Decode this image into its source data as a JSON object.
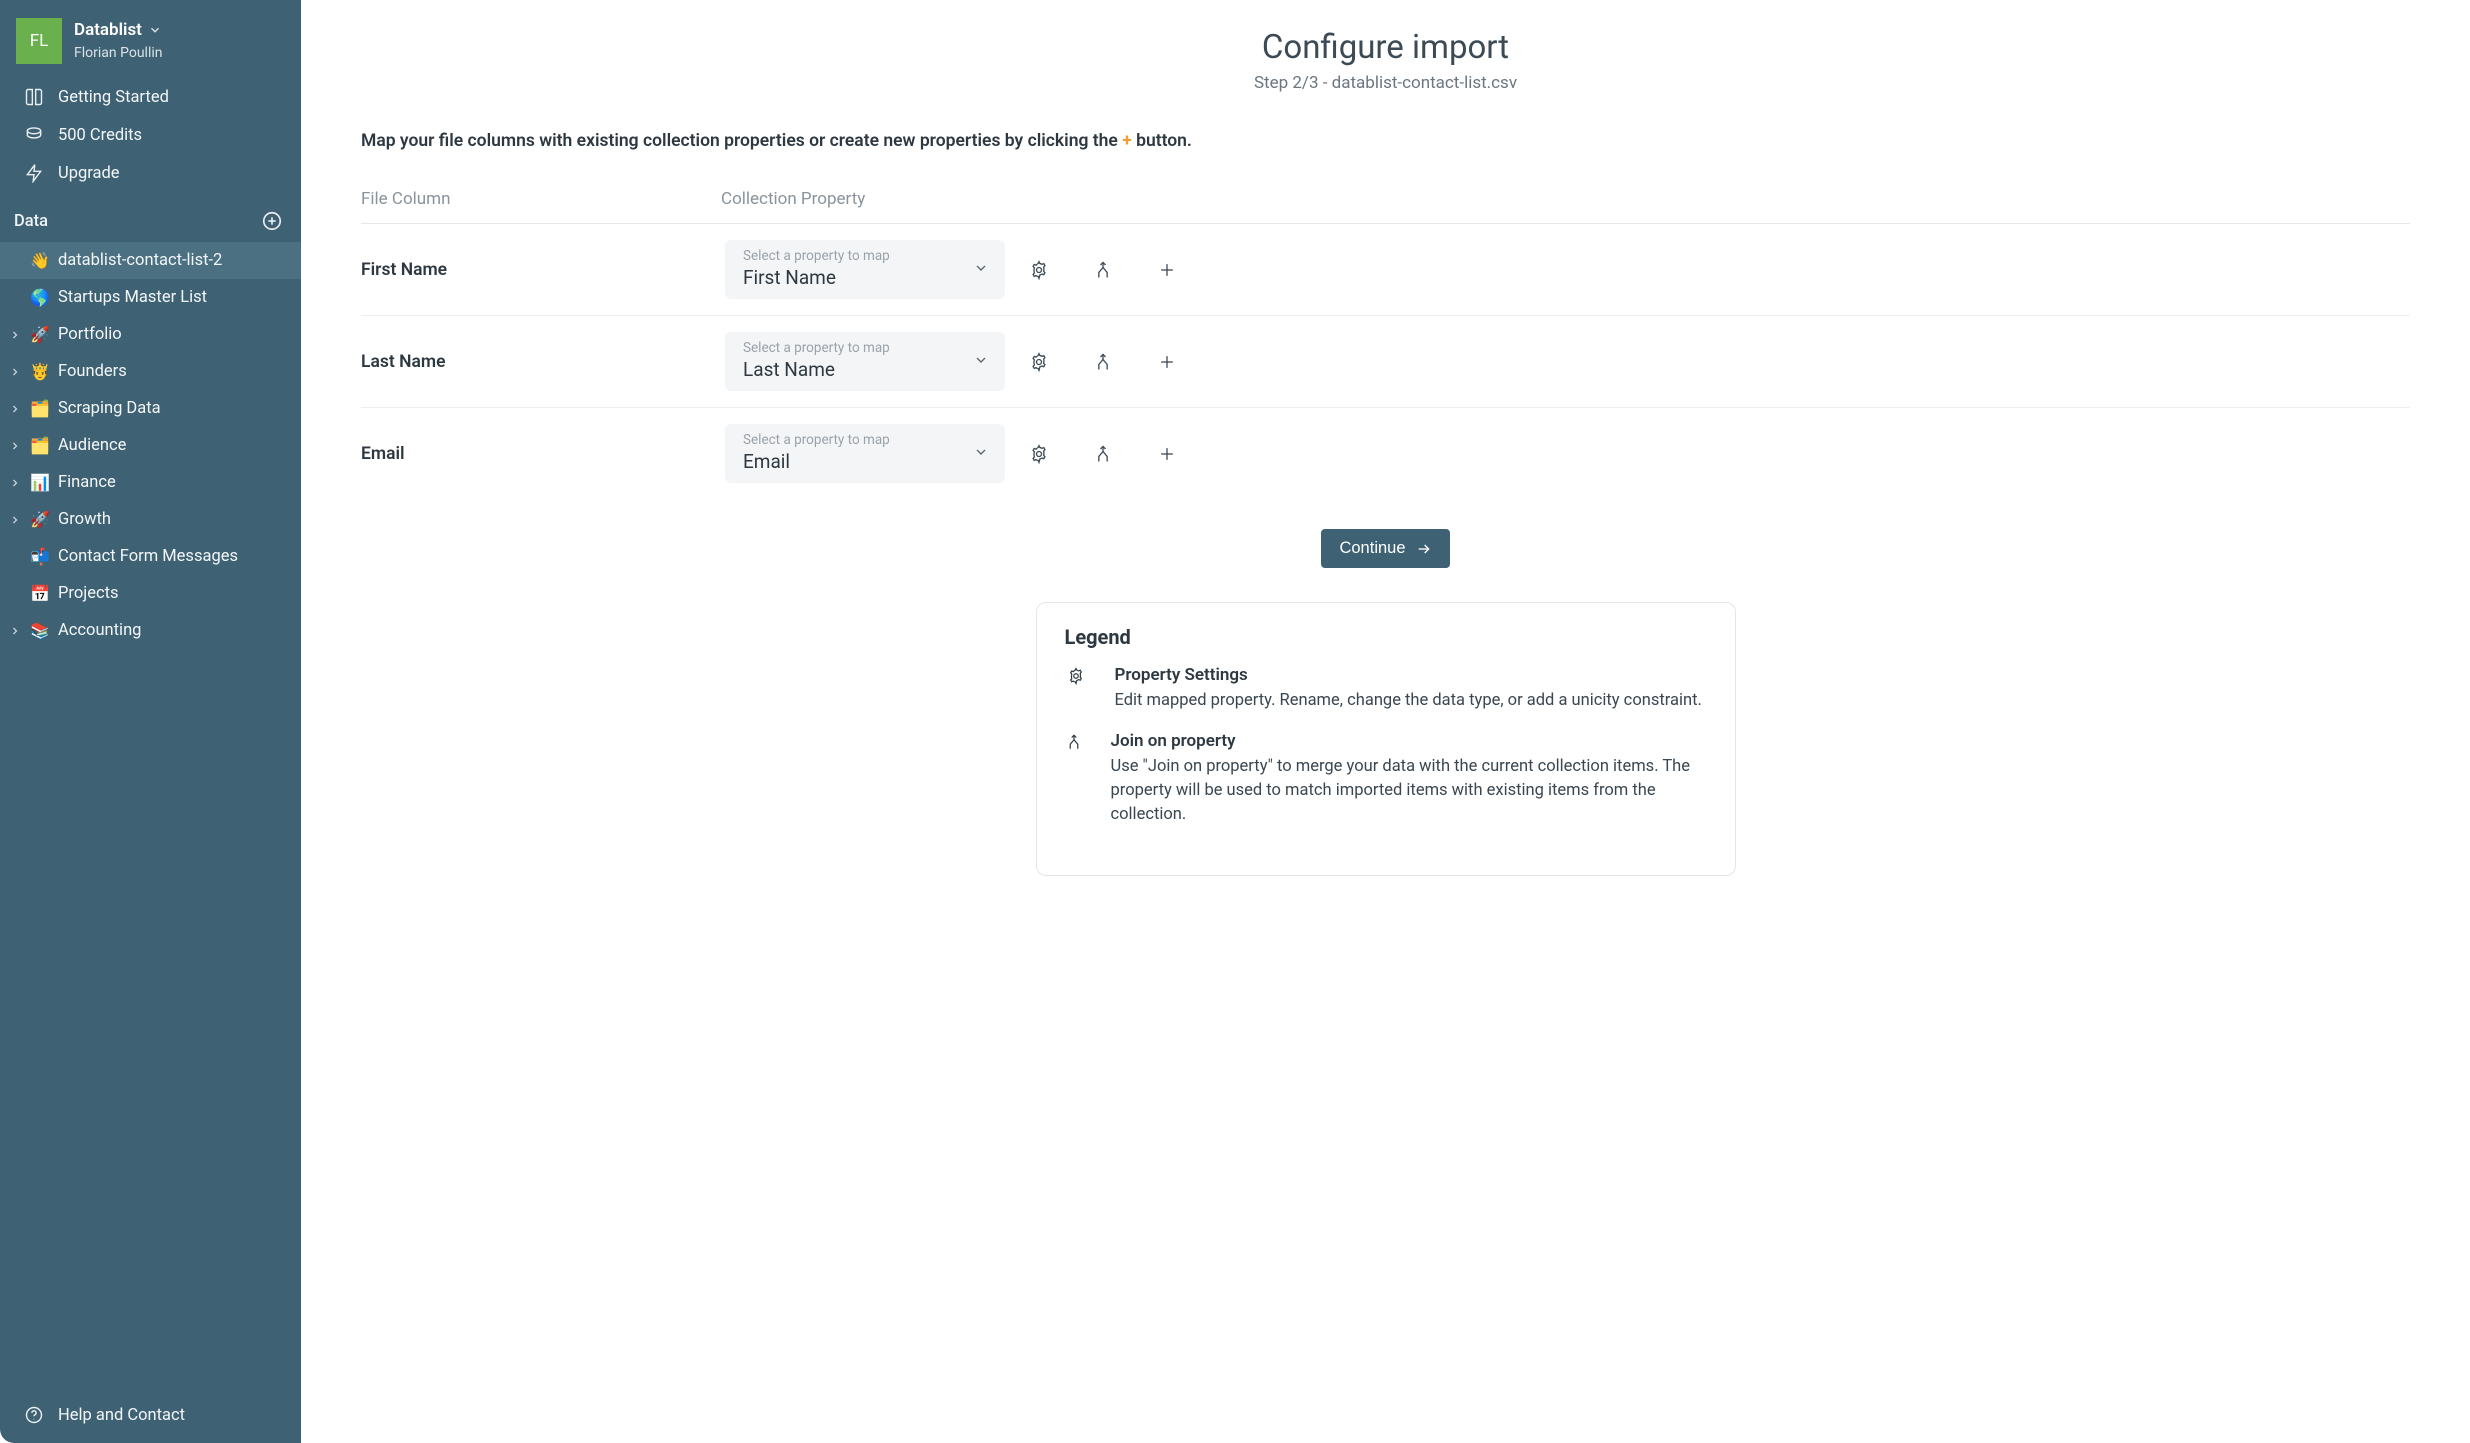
{
  "sidebar": {
    "avatar_initials": "FL",
    "workspace_name": "Datablist",
    "user_name": "Florian Poullin",
    "nav": {
      "getting_started": "Getting Started",
      "credits": "500 Credits",
      "upgrade": "Upgrade"
    },
    "data_section_label": "Data",
    "collections": [
      {
        "emoji": "👋",
        "label": "datablist-contact-list-2",
        "expandable": false,
        "active": true
      },
      {
        "emoji": "🌎",
        "label": "Startups Master List",
        "expandable": false,
        "active": false
      },
      {
        "emoji": "🚀",
        "label": "Portfolio",
        "expandable": true,
        "active": false
      },
      {
        "emoji": "🤴",
        "label": "Founders",
        "expandable": true,
        "active": false
      },
      {
        "emoji": "🗂️",
        "label": "Scraping Data",
        "expandable": true,
        "active": false
      },
      {
        "emoji": "🗂️",
        "label": "Audience",
        "expandable": true,
        "active": false
      },
      {
        "emoji": "📊",
        "label": "Finance",
        "expandable": true,
        "active": false
      },
      {
        "emoji": "🚀",
        "label": "Growth",
        "expandable": true,
        "active": false
      },
      {
        "emoji": "📬",
        "label": "Contact Form Messages",
        "expandable": false,
        "active": false
      },
      {
        "emoji": "📅",
        "label": "Projects",
        "expandable": false,
        "active": false
      },
      {
        "emoji": "📚",
        "label": "Accounting",
        "expandable": true,
        "active": false
      }
    ],
    "help_label": "Help and Contact"
  },
  "main": {
    "title": "Configure import",
    "subtitle": "Step 2/3 - datablist-contact-list.csv",
    "instruction_pre": "Map your file columns with existing collection properties or create new properties by clicking the ",
    "instruction_plus": "+",
    "instruction_post": " button.",
    "headers": {
      "file_column": "File Column",
      "collection_property": "Collection Property"
    },
    "select_hint": "Select a property to map",
    "rows": [
      {
        "file_column": "First Name",
        "property_value": "First Name"
      },
      {
        "file_column": "Last Name",
        "property_value": "Last Name"
      },
      {
        "file_column": "Email",
        "property_value": "Email"
      }
    ],
    "continue_label": "Continue",
    "legend": {
      "title": "Legend",
      "items": [
        {
          "title": "Property Settings",
          "desc": "Edit mapped property. Rename, change the data type, or add a unicity constraint."
        },
        {
          "title": "Join on property",
          "desc": "Use \"Join on property\" to merge your data with the current collection items. The property will be used to match imported items with existing items from the collection."
        }
      ]
    }
  }
}
